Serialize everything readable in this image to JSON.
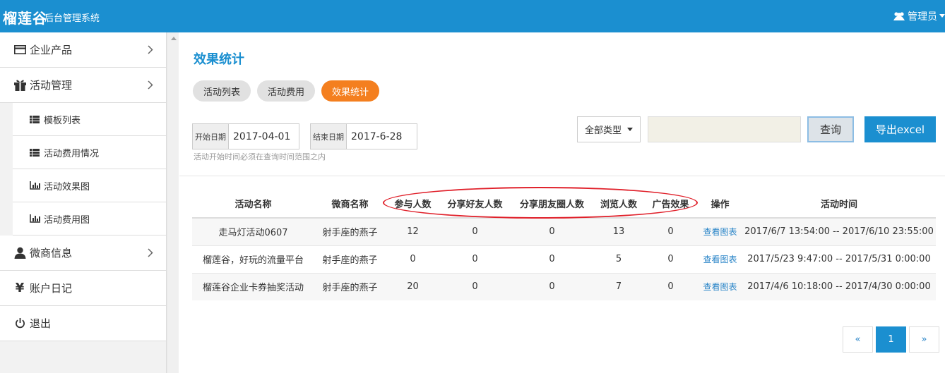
{
  "header": {
    "brand": "榴莲谷",
    "subtitle": "后台管理系统",
    "user": "管理员"
  },
  "sidebar": {
    "items": [
      {
        "label": "企业产品",
        "icon": "card-icon"
      },
      {
        "label": "活动管理",
        "icon": "gift-icon"
      },
      {
        "label": "微商信息",
        "icon": "user-icon"
      },
      {
        "label": "账户日记",
        "icon": "yen-icon"
      },
      {
        "label": "退出",
        "icon": "power-icon"
      }
    ],
    "subitems": [
      {
        "label": "模板列表",
        "icon": "list-icon"
      },
      {
        "label": "活动费用情况",
        "icon": "list-icon"
      },
      {
        "label": "活动效果图",
        "icon": "bar-chart-icon"
      },
      {
        "label": "活动费用图",
        "icon": "bar-chart-icon"
      }
    ]
  },
  "main": {
    "title": "效果统计",
    "tabs": [
      "活动列表",
      "活动费用",
      "效果统计"
    ],
    "active_tab": "效果统计",
    "start_label": "开始日期",
    "start_value": "2017-04-01",
    "end_label": "结束日期",
    "end_value": "2017-6-28",
    "hint": "活动开始时间必须在查询时间范围之内",
    "type_select": "全部类型",
    "query_button": "查询",
    "export_button": "导出excel"
  },
  "table": {
    "headers": [
      "活动名称",
      "微商名称",
      "参与人数",
      "分享好友人数",
      "分享朋友圈人数",
      "浏览人数",
      "广告效果",
      "操作",
      "活动时间"
    ],
    "rows": [
      {
        "name": "走马灯活动0607",
        "merchant": "射手座的燕子",
        "participants": "12",
        "share_friends": "0",
        "share_moments": "0",
        "views": "13",
        "ad_effect": "0",
        "action": "查看图表",
        "time": "2017/6/7 13:54:00 -- 2017/6/10 23:55:00"
      },
      {
        "name": "榴莲谷，好玩的流量平台",
        "merchant": "射手座的燕子",
        "participants": "0",
        "share_friends": "0",
        "share_moments": "0",
        "views": "5",
        "ad_effect": "0",
        "action": "查看图表",
        "time": "2017/5/23 9:47:00 -- 2017/5/31 0:00:00"
      },
      {
        "name": "榴莲谷企业卡券抽奖活动",
        "merchant": "射手座的燕子",
        "participants": "20",
        "share_friends": "0",
        "share_moments": "0",
        "views": "7",
        "ad_effect": "0",
        "action": "查看图表",
        "time": "2017/4/6 10:18:00 -- 2017/4/30 0:00:00"
      }
    ]
  },
  "pagination": {
    "prev": "«",
    "current": "1",
    "next": "»"
  },
  "colors": {
    "primary": "#1b8fd0",
    "active_tab": "#f47f1f",
    "annotation": "#e0202a"
  }
}
